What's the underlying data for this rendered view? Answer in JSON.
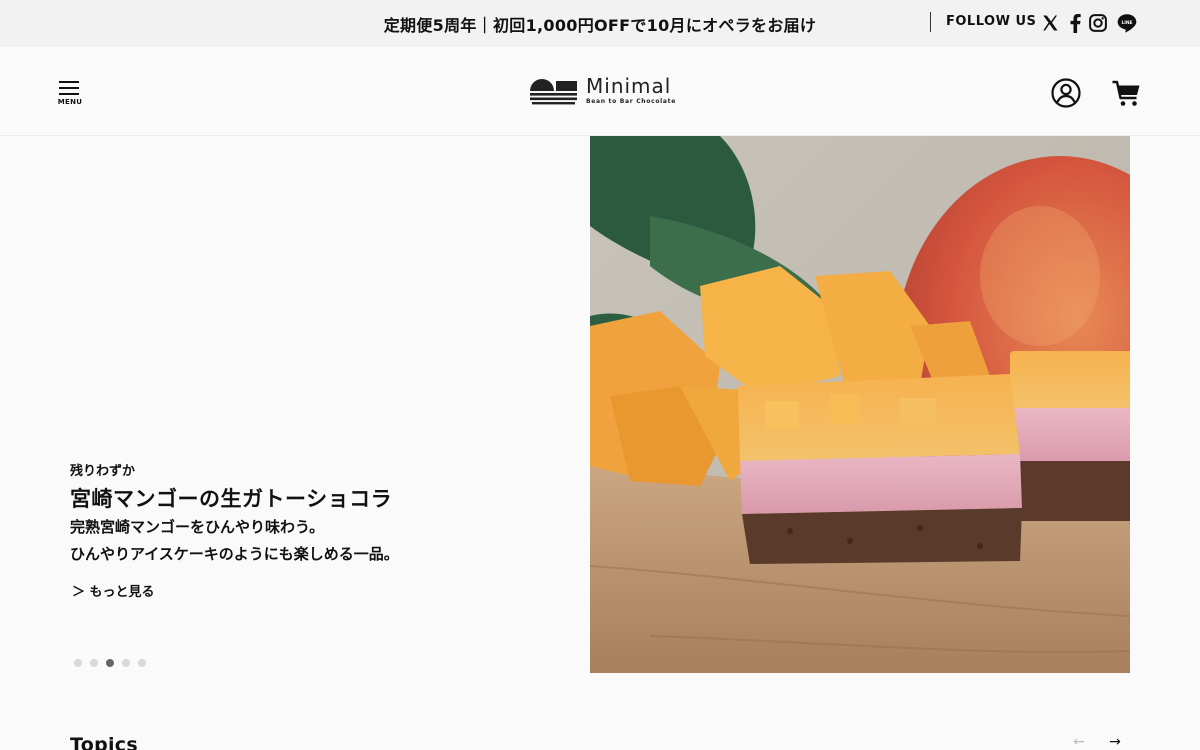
{
  "announcement": "定期便5周年｜初回1,000円OFFで10月にオペラをお届け",
  "follow_us": "FOLLOW US",
  "social_icons": [
    "x-icon",
    "facebook-icon",
    "instagram-icon",
    "line-icon"
  ],
  "social_line_text": "LINE",
  "menu_label": "MENU",
  "logo": {
    "name": "Minimal",
    "tagline": "Bean to Bar Chocolate"
  },
  "header_icons": [
    "account-icon",
    "cart-icon"
  ],
  "hero": {
    "kicker": "残りわずか",
    "title": "宮崎マンゴーの生ガトーショコラ",
    "desc_line1": "完熟宮崎マンゴーをひんやり味わう。",
    "desc_line2": "ひんやりアイスケーキのようにも楽しめる一品。",
    "more_link": "＞ もっと見る",
    "slides_total": 5,
    "active_slide": 3
  },
  "topics": {
    "title": "Topics",
    "prev_arrow": "←",
    "next_arrow": "→"
  },
  "colors": {
    "topbar_bg": "#f2f2f2",
    "page_bg": "#fafafa",
    "text": "#111111",
    "dot_active": "#666666",
    "dot_inactive": "#d8d8d8"
  }
}
